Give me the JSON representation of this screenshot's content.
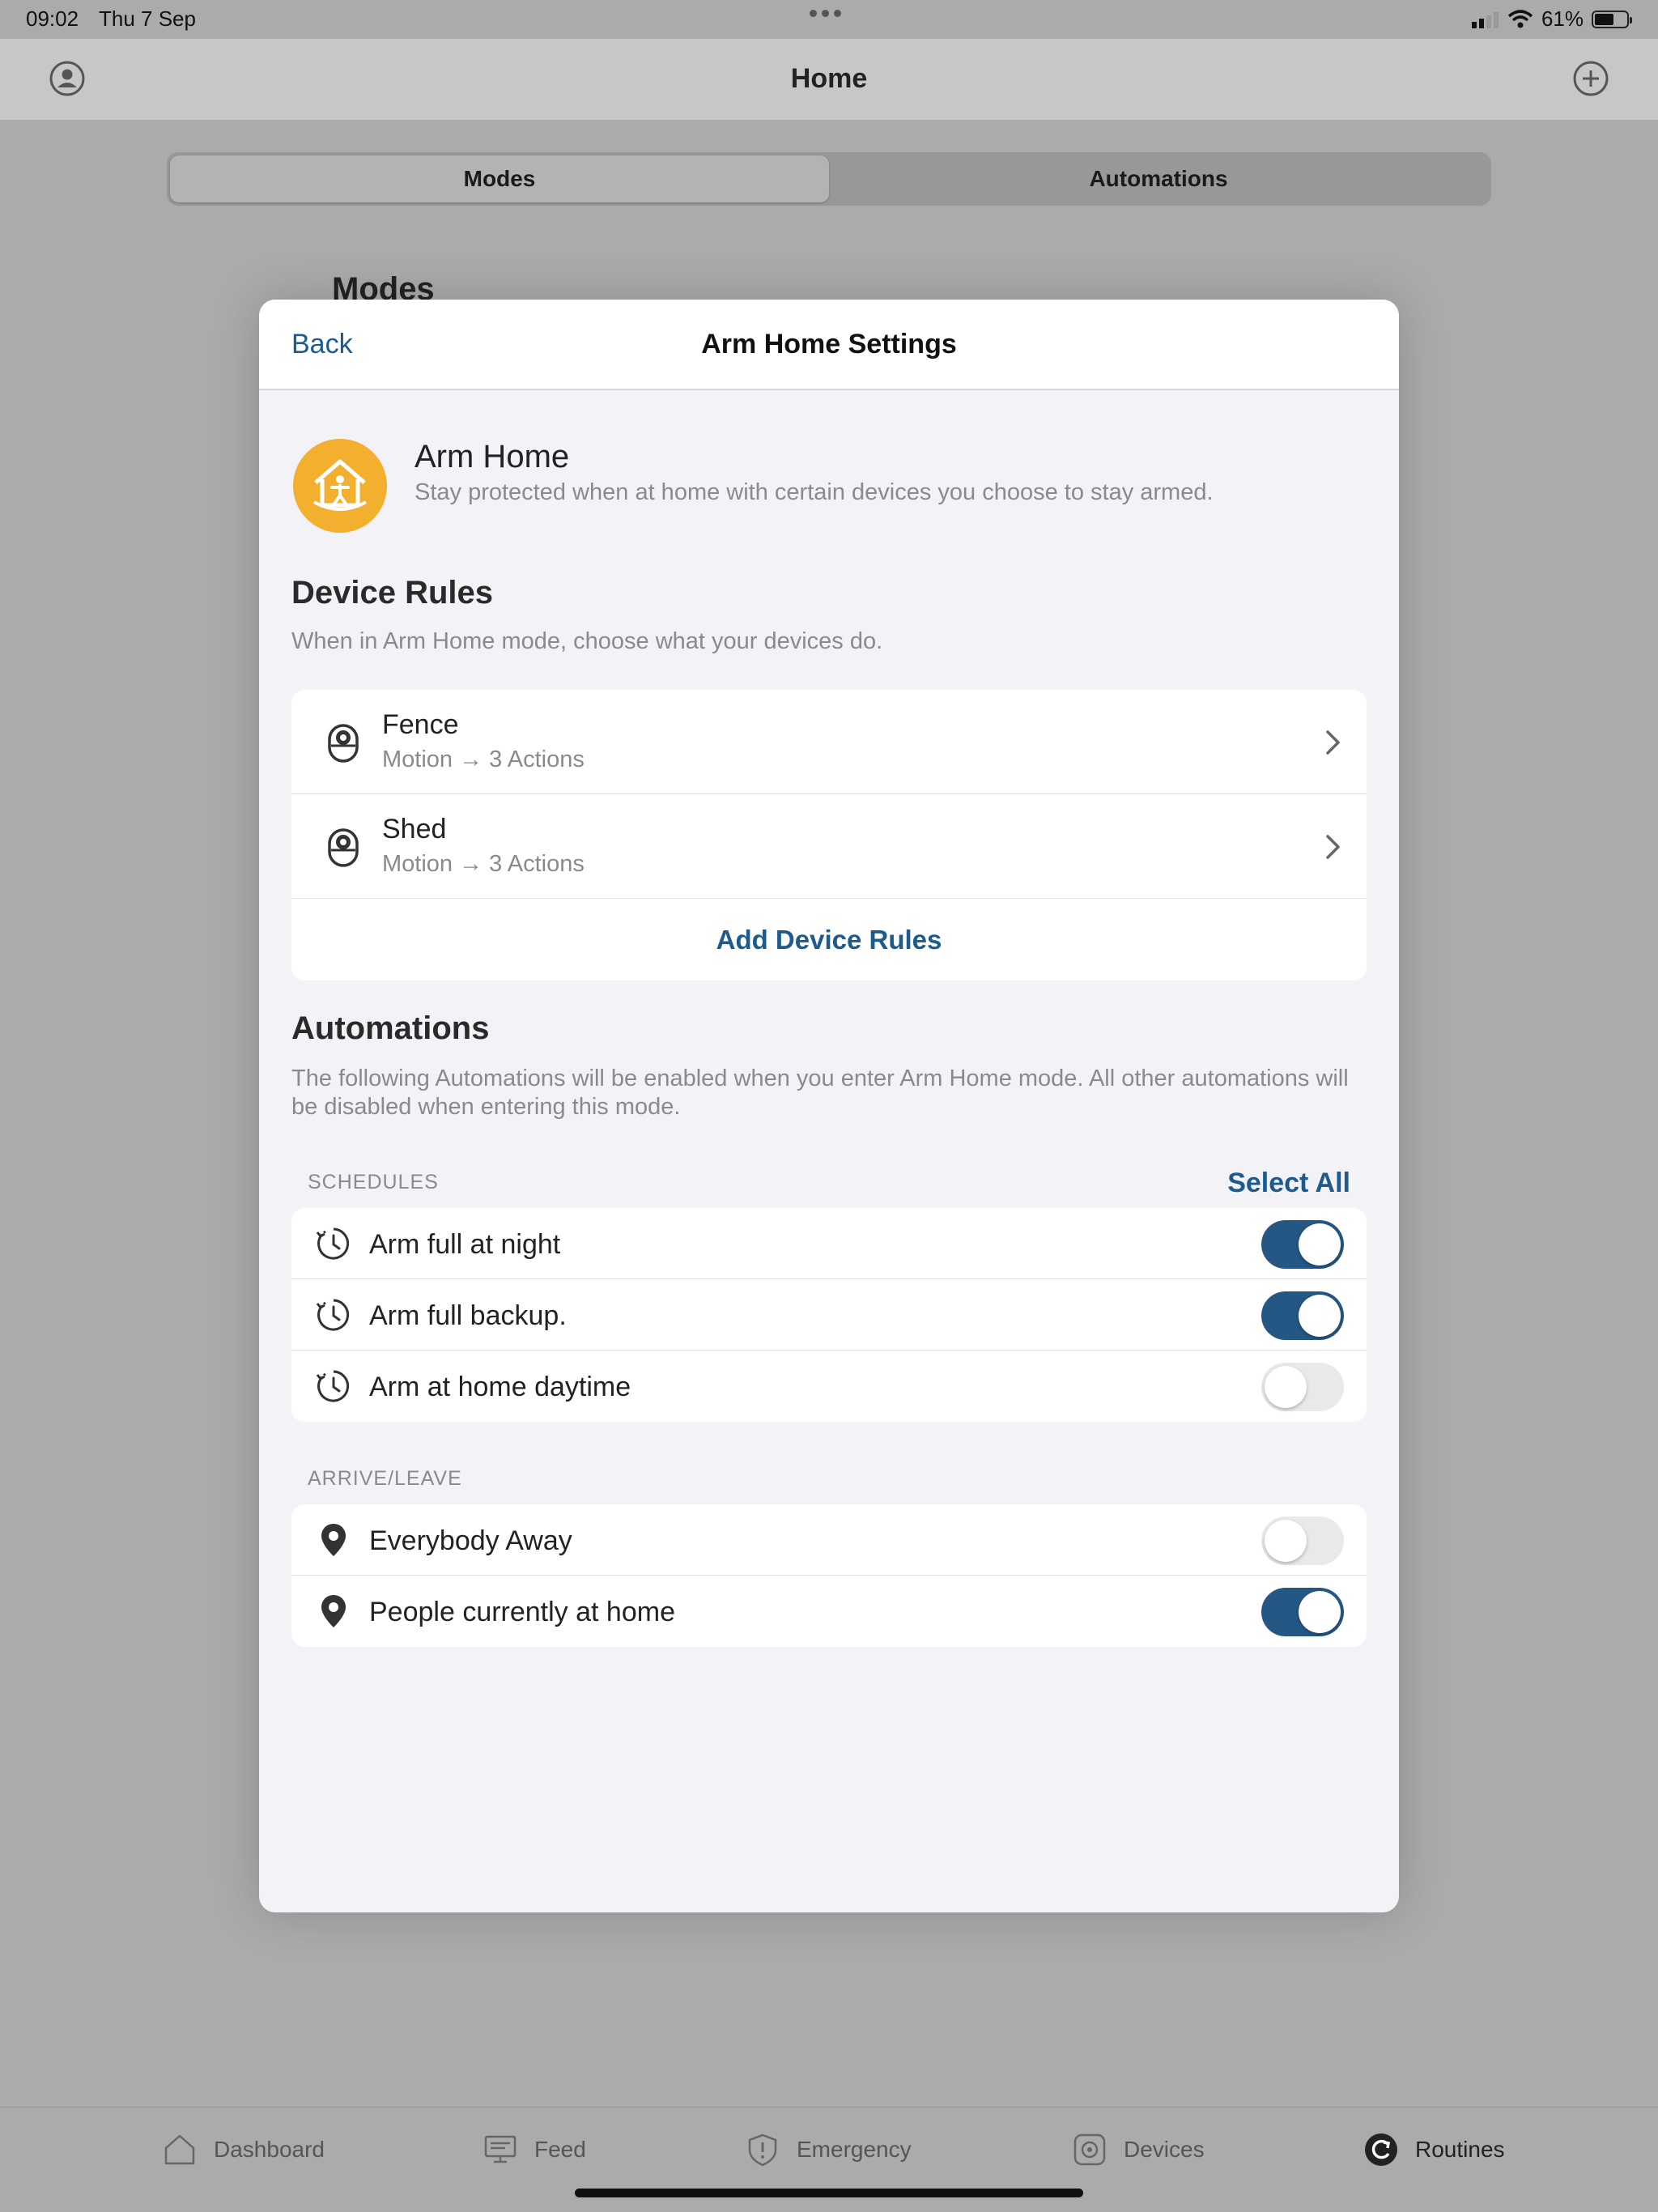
{
  "status_bar": {
    "time": "09:02",
    "date": "Thu 7 Sep",
    "battery": "61%"
  },
  "nav": {
    "title": "Home"
  },
  "segmented": {
    "modes": "Modes",
    "automations": "Automations"
  },
  "background": {
    "section_title": "Modes"
  },
  "modal": {
    "back_label": "Back",
    "title": "Arm Home Settings",
    "mode": {
      "name": "Arm Home",
      "description": "Stay protected when at home with certain devices you choose to stay armed.",
      "icon_color": "#f2b02e"
    },
    "device_rules": {
      "title": "Device Rules",
      "description": "When in Arm Home mode, choose what your devices do.",
      "items": [
        {
          "name": "Fence",
          "detail": "Motion → 3 Actions"
        },
        {
          "name": "Shed",
          "detail": "Motion → 3 Actions"
        }
      ],
      "add_label": "Add Device Rules"
    },
    "automations": {
      "title": "Automations",
      "description": "The following Automations will be enabled when you enter Arm Home mode. All other automations will be disabled when entering this mode.",
      "schedules_label": "SCHEDULES",
      "select_all": "Select All",
      "schedules": [
        {
          "label": "Arm full at night",
          "enabled": true
        },
        {
          "label": "Arm full backup.",
          "enabled": true
        },
        {
          "label": "Arm at home daytime",
          "enabled": false
        }
      ],
      "arrive_leave_label": "ARRIVE/LEAVE",
      "arrive_leave": [
        {
          "label": "Everybody Away",
          "enabled": false
        },
        {
          "label": "People currently at home",
          "enabled": true
        }
      ]
    }
  },
  "tab_bar": {
    "tabs": [
      {
        "label": "Dashboard",
        "icon": "house-icon"
      },
      {
        "label": "Feed",
        "icon": "monitor-icon"
      },
      {
        "label": "Emergency",
        "icon": "shield-icon"
      },
      {
        "label": "Devices",
        "icon": "camera-icon"
      },
      {
        "label": "Routines",
        "icon": "routines-icon"
      }
    ],
    "active": "Routines"
  },
  "colors": {
    "accent": "#1d5b8c",
    "toggle_on": "#245783",
    "mode_icon": "#f2b02e"
  }
}
